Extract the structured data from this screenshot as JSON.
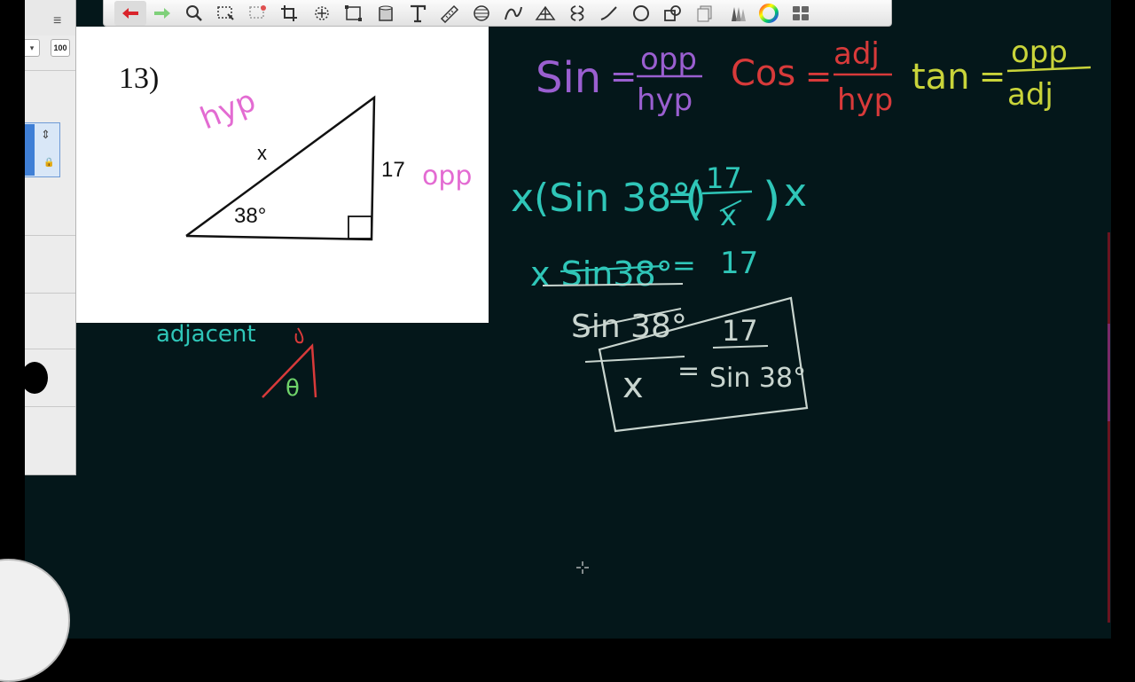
{
  "toolbar": {
    "tools": [
      {
        "name": "undo-icon",
        "glyph": "↩"
      },
      {
        "name": "redo-icon",
        "glyph": "↪"
      },
      {
        "name": "zoom-icon",
        "glyph": "🔍"
      },
      {
        "name": "lasso-select-icon",
        "glyph": "⬚"
      },
      {
        "name": "marquee-select-icon",
        "glyph": "⬚"
      },
      {
        "name": "crop-icon",
        "glyph": "⌗"
      },
      {
        "name": "transform-icon",
        "glyph": "✥"
      },
      {
        "name": "distort-icon",
        "glyph": "◇"
      },
      {
        "name": "fill-bucket-icon",
        "glyph": "▾"
      },
      {
        "name": "text-icon",
        "glyph": "T"
      },
      {
        "name": "ruler-icon",
        "glyph": "📏"
      },
      {
        "name": "ellipse-guide-icon",
        "glyph": "◎"
      },
      {
        "name": "curve-guide-icon",
        "glyph": "∿"
      },
      {
        "name": "perspective-guide-icon",
        "glyph": "⌂"
      },
      {
        "name": "symmetry-icon",
        "glyph": "Ƹ"
      },
      {
        "name": "line-tool-icon",
        "glyph": "╱"
      },
      {
        "name": "circle-tool-icon",
        "glyph": "○"
      },
      {
        "name": "shapes-icon",
        "glyph": "◰"
      },
      {
        "name": "copy-layer-icon",
        "glyph": "⧉"
      },
      {
        "name": "brushes-icon",
        "glyph": "✎"
      },
      {
        "name": "color-wheel-icon",
        "glyph": "●"
      },
      {
        "name": "layers-grid-icon",
        "glyph": "▦"
      }
    ],
    "accent_undo": "#d9242b",
    "accent_redo": "#7fd07a"
  },
  "left_panel": {
    "menu_glyph": "≡",
    "dropdown_glyph": "▾",
    "zoom_value": "100",
    "layer_arrows_glyph": "⇕",
    "layer_lock_glyph": "🔒"
  },
  "worksheet": {
    "problem_number": "13)",
    "side_label_x": "x",
    "side_label_opposite": "17",
    "angle_label": "38°"
  },
  "ink": {
    "hyp_label": "hyp",
    "opp_label": "opp",
    "adjacent_label": "adjacent",
    "theta": "θ",
    "sin": "Sin",
    "sin_eq": "=",
    "sin_num": "opp",
    "sin_den": "hyp",
    "cos": "Cos",
    "cos_eq": "=",
    "cos_num": "adj",
    "cos_den": "hyp",
    "tan": "tan",
    "tan_eq": "=",
    "tan_num": "opp",
    "tan_den": "adj",
    "step1_left": "x(Sin 38°)",
    "step1_eq": "=",
    "step1_num": "17",
    "step1_den": "x",
    "step1_times": "x",
    "step2_left": "x Sin38°",
    "step2_eq": "=",
    "step2_right": "17",
    "step2_den": "Sin 38°",
    "answer_x": "x",
    "answer_eq": "=",
    "answer_num": "17",
    "answer_den": "Sin 38°"
  },
  "colors": {
    "board": "#04171a",
    "pink": "#e36bd2",
    "purple": "#9a5fd0",
    "red": "#d83a3a",
    "yellow_green": "#c9d43a",
    "teal": "#2fc6b8",
    "light_gray_ink": "#c9d5cf",
    "green_theta": "#6fd36a"
  }
}
